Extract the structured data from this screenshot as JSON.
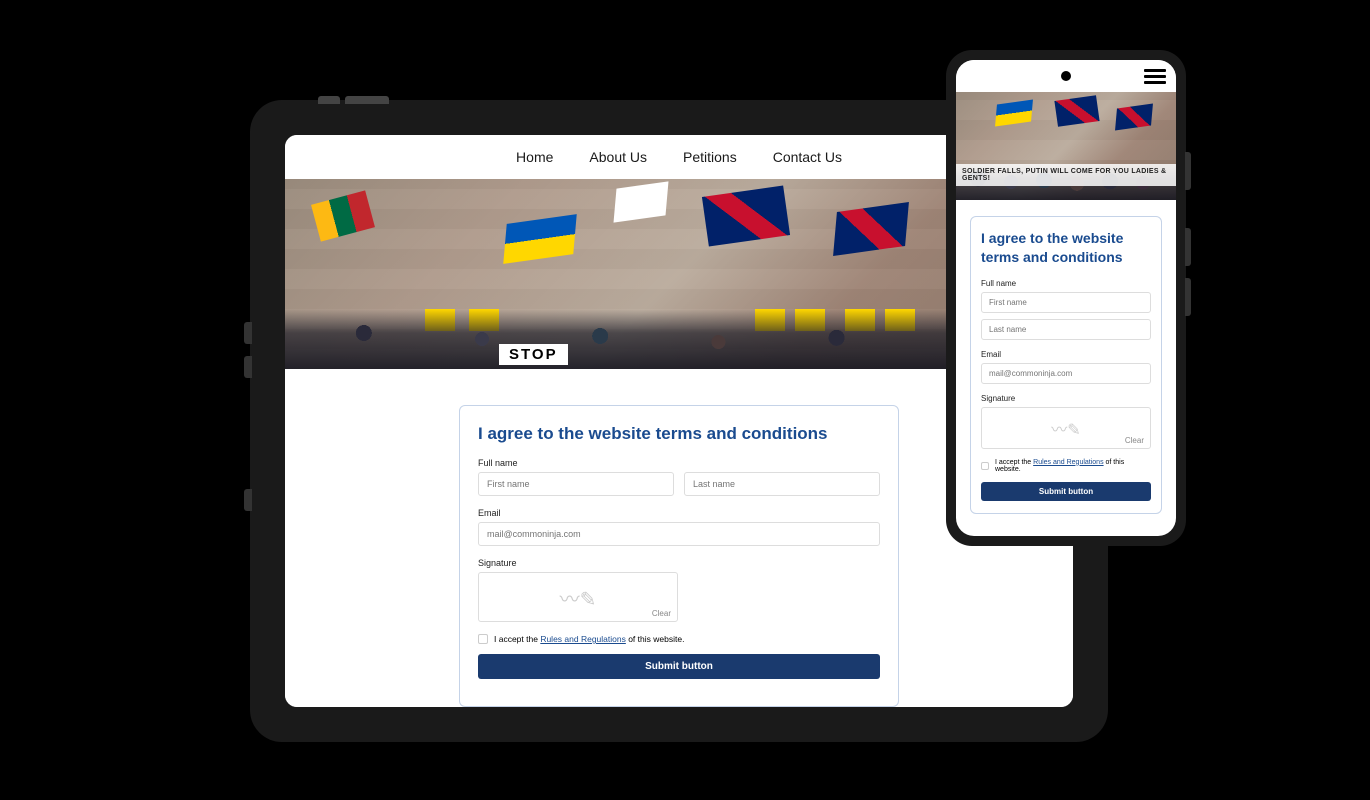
{
  "nav": {
    "home": "Home",
    "about": "About Us",
    "petitions": "Petitions",
    "contact": "Contact Us"
  },
  "hero": {
    "stop_sign": "STOP",
    "banner": "SOLDIER FALLS, PUTIN WILL COME FOR YOU LADIES & GENTS!"
  },
  "form": {
    "title": "I agree to the website terms and conditions",
    "full_name_label": "Full name",
    "first_name_placeholder": "First name",
    "last_name_placeholder": "Last name",
    "email_label": "Email",
    "email_placeholder": "mail@commoninja.com",
    "signature_label": "Signature",
    "clear": "Clear",
    "accept_prefix": "I accept the ",
    "rules_link": "Rules and Regulations",
    "accept_suffix": " of this website.",
    "submit": "Submit button"
  }
}
